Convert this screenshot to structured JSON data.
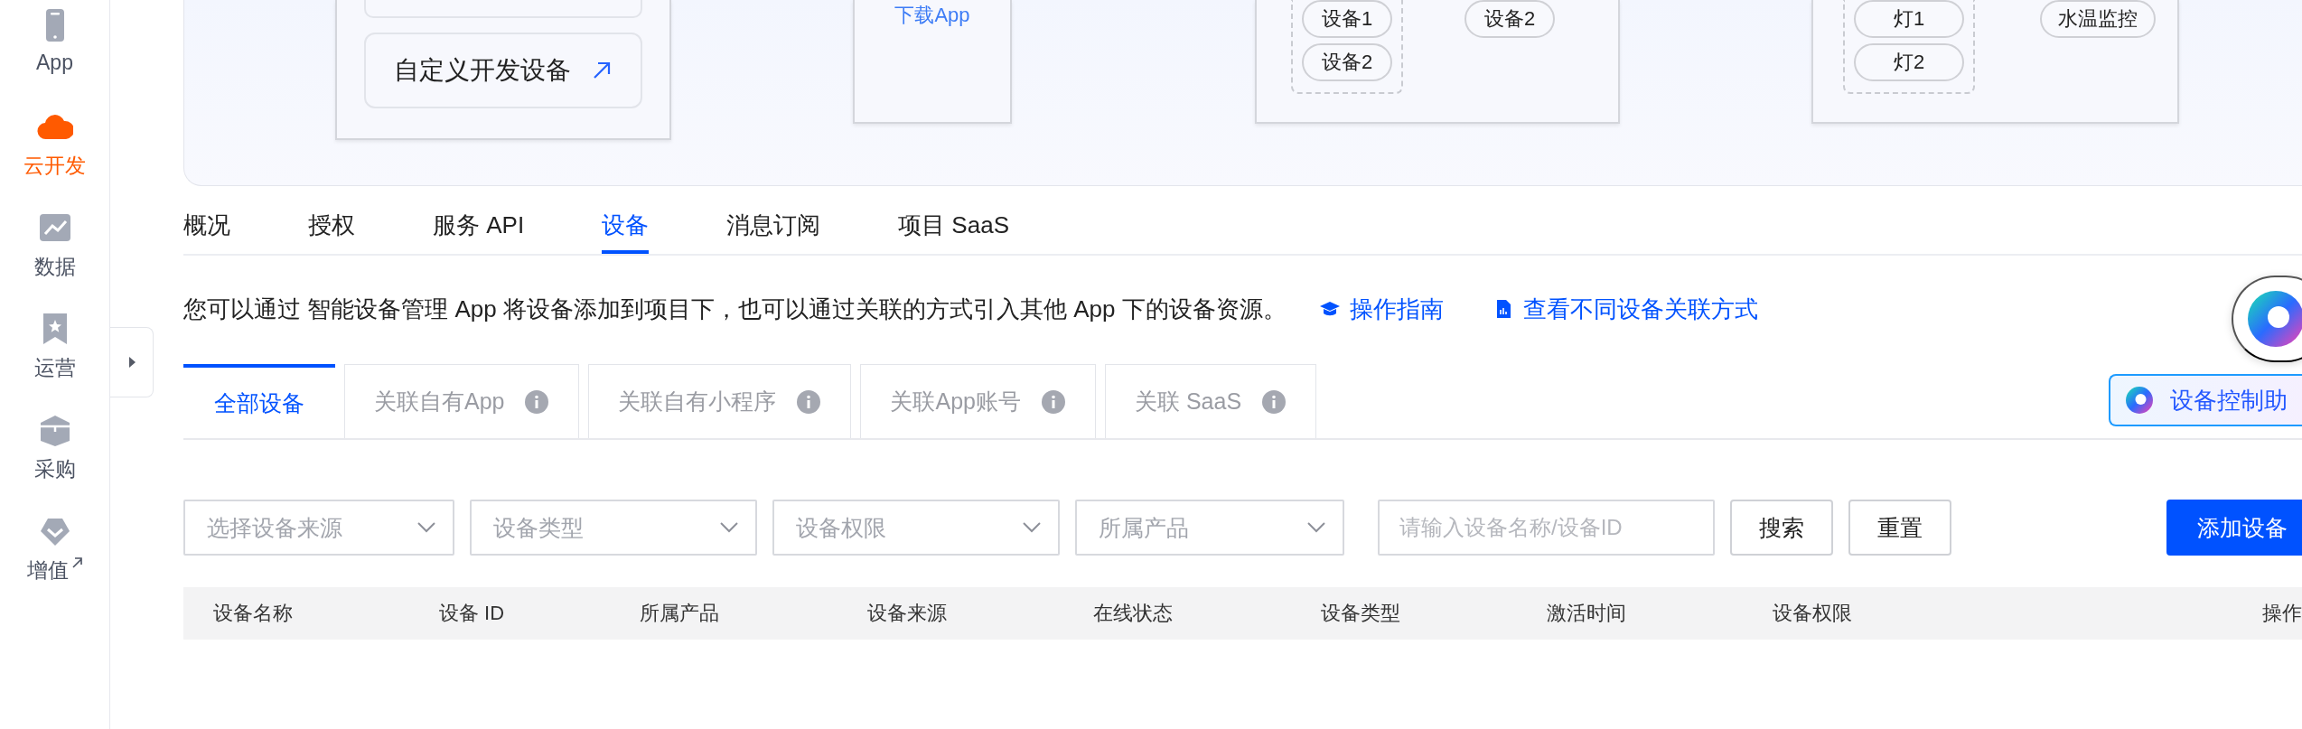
{
  "sidebar": {
    "items": [
      {
        "label": "App",
        "selected": false,
        "external": false
      },
      {
        "label": "云开发",
        "selected": true,
        "external": false
      },
      {
        "label": "数据",
        "selected": false,
        "external": false
      },
      {
        "label": "运营",
        "selected": false,
        "external": false
      },
      {
        "label": "采购",
        "selected": false,
        "external": false
      },
      {
        "label": "增值",
        "selected": false,
        "external": true
      }
    ]
  },
  "banner": {
    "cards": [
      {
        "kind": "options",
        "items": [
          {
            "label": "自定义开发设备",
            "external": true
          }
        ]
      },
      {
        "kind": "download",
        "link": "下载App"
      },
      {
        "kind": "devices",
        "group": [
          "设备1",
          "设备2"
        ],
        "others": [
          "设备2"
        ]
      },
      {
        "kind": "devices",
        "group": [
          "灯1",
          "灯2"
        ],
        "others": [
          "水温监控"
        ]
      }
    ]
  },
  "tabs": [
    {
      "label": "概况",
      "selected": false
    },
    {
      "label": "授权",
      "selected": false
    },
    {
      "label": "服务 API",
      "selected": false
    },
    {
      "label": "设备",
      "selected": true
    },
    {
      "label": "消息订阅",
      "selected": false
    },
    {
      "label": "项目 SaaS",
      "selected": false
    }
  ],
  "description": {
    "text": "您可以通过 智能设备管理 App 将设备添加到项目下，也可以通过关联的方式引入其他 App 下的设备资源。",
    "links": [
      {
        "label": "操作指南"
      },
      {
        "label": "查看不同设备关联方式"
      }
    ]
  },
  "device_tabs": [
    {
      "label": "全部设备",
      "selected": true,
      "info": false
    },
    {
      "label": "关联自有App",
      "selected": false,
      "info": true
    },
    {
      "label": "关联自有小程序",
      "selected": false,
      "info": true
    },
    {
      "label": "关联App账号",
      "selected": false,
      "info": true
    },
    {
      "label": "关联 SaaS",
      "selected": false,
      "info": true
    }
  ],
  "assistant_button": {
    "label": "设备控制助"
  },
  "filters": [
    {
      "kind": "select",
      "placeholder": "选择设备来源"
    },
    {
      "kind": "select",
      "placeholder": "设备类型"
    },
    {
      "kind": "select",
      "placeholder": "设备权限"
    },
    {
      "kind": "select",
      "placeholder": "所属产品"
    },
    {
      "kind": "input",
      "placeholder": "请输入设备名称/设备ID"
    }
  ],
  "buttons": [
    {
      "label": "搜索",
      "kind": "default"
    },
    {
      "label": "重置",
      "kind": "default"
    },
    {
      "label": "添加设备",
      "kind": "primary"
    }
  ],
  "table": {
    "columns": [
      "设备名称",
      "设备 ID",
      "所属产品",
      "设备来源",
      "在线状态",
      "设备类型",
      "激活时间",
      "设备权限",
      "操作"
    ]
  }
}
